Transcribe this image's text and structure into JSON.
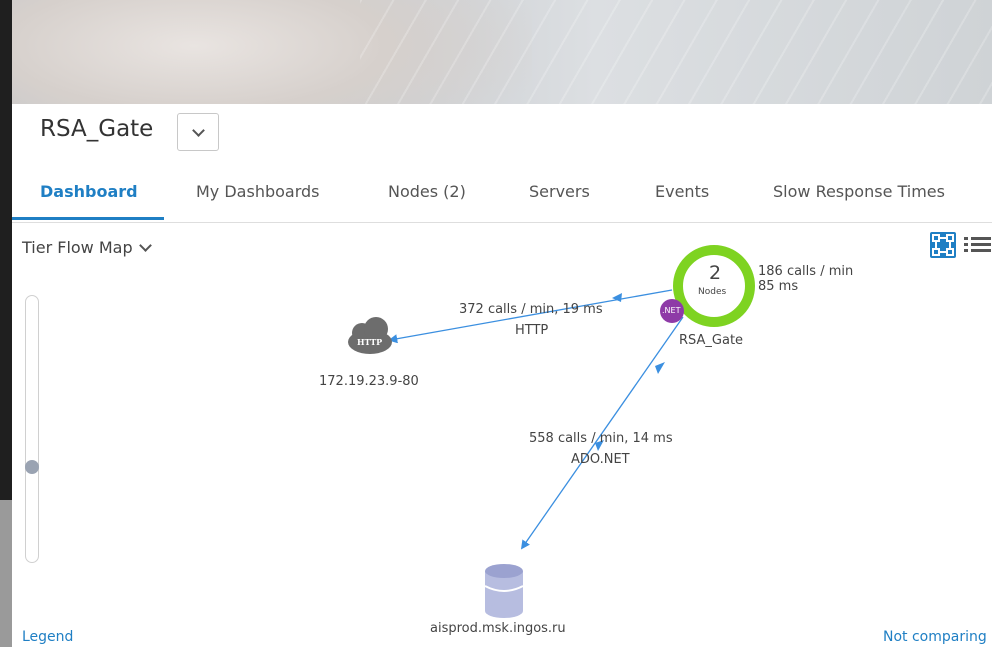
{
  "app": {
    "title": "RSA_Gate"
  },
  "tabs": [
    {
      "label": "Dashboard",
      "active": true
    },
    {
      "label": "My Dashboards"
    },
    {
      "label": "Nodes (2)"
    },
    {
      "label": "Servers"
    },
    {
      "label": "Events"
    },
    {
      "label": "Slow Response Times"
    }
  ],
  "view": {
    "selector": "Tier Flow Map"
  },
  "map": {
    "tier": {
      "count": "2",
      "count_label": "Nodes",
      "name": "RSA_Gate",
      "badge": ".NET",
      "ring_color": "#7ed321"
    },
    "incoming": {
      "calls": "186 calls / min",
      "time": "85 ms"
    },
    "http_edge": {
      "calls": "372 calls / min, 19 ms",
      "protocol": "HTTP"
    },
    "http_backend": {
      "icon_text": "HTTP",
      "name": "172.19.23.9-80"
    },
    "db_edge": {
      "calls": "558 calls / min, 14 ms",
      "protocol": "ADO.NET"
    },
    "db_backend": {
      "name": "aisprod.msk.ingos.ru"
    },
    "edge_color": "#3b8fe0",
    "db_color": "#b7bde0",
    "net_badge_color": "#8e3aa7"
  },
  "footer": {
    "legend": "Legend",
    "status": "Not comparing"
  },
  "colors": {
    "accent": "#1f7fc4"
  }
}
